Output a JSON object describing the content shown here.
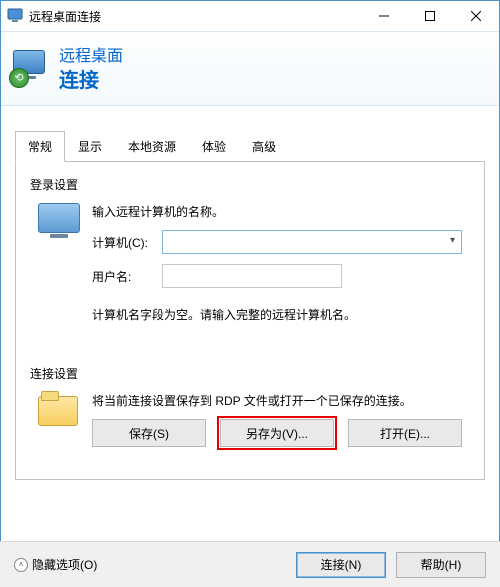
{
  "window": {
    "title": "远程桌面连接",
    "header_line1": "远程桌面",
    "header_line2": "连接"
  },
  "tabs": [
    {
      "id": "general",
      "label": "常规",
      "active": true
    },
    {
      "id": "display",
      "label": "显示",
      "active": false
    },
    {
      "id": "localres",
      "label": "本地资源",
      "active": false
    },
    {
      "id": "experience",
      "label": "体验",
      "active": false
    },
    {
      "id": "advanced",
      "label": "高级",
      "active": false
    }
  ],
  "login": {
    "group_title": "登录设置",
    "prompt": "输入远程计算机的名称。",
    "computer_label": "计算机(C):",
    "computer_value": "",
    "username_label": "用户名:",
    "username_value": "",
    "hint": "计算机名字段为空。请输入完整的远程计算机名。"
  },
  "conn": {
    "group_title": "连接设置",
    "desc": "将当前连接设置保存到 RDP 文件或打开一个已保存的连接。",
    "save_label": "保存(S)",
    "saveas_label": "另存为(V)...",
    "open_label": "打开(E)..."
  },
  "footer": {
    "hide_options": "隐藏选项(O)",
    "connect": "连接(N)",
    "help": "帮助(H)"
  }
}
